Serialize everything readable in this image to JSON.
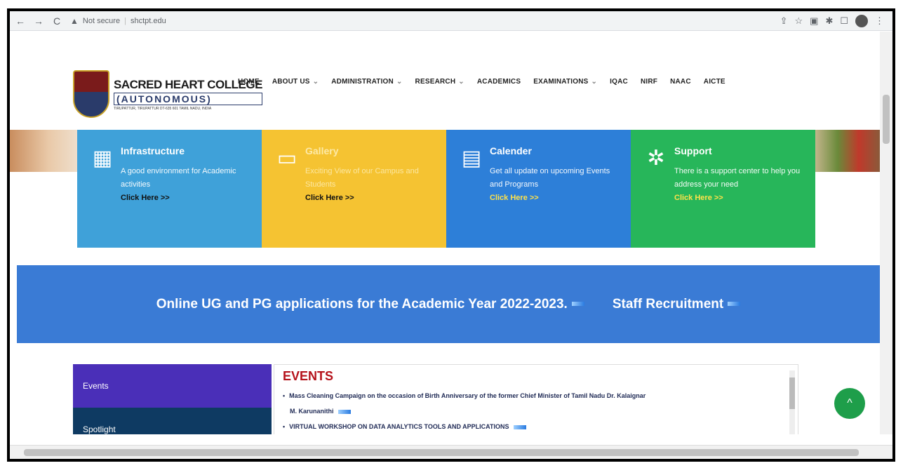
{
  "browser": {
    "back_icon": "←",
    "forward_icon": "→",
    "reload_icon": "C",
    "security_label": "Not secure",
    "url": "shctpt.edu",
    "toolbar_icons": [
      "share-icon",
      "star-icon",
      "extension-icon",
      "puzzle-icon",
      "window-icon",
      "profile-icon",
      "menu-icon"
    ]
  },
  "header": {
    "college_name": "SACRED HEART COLLEGE",
    "college_sub": "(AUTONOMOUS)",
    "college_address": "TIRUPATTUR, TIRUPATTUR DT-635 601 TAMIL NADU, INDIA",
    "nav": [
      {
        "label": "HOME",
        "caret": false
      },
      {
        "label": "ABOUT US",
        "caret": true
      },
      {
        "label": "ADMINISTRATION",
        "caret": true
      },
      {
        "label": "RESEARCH",
        "caret": true
      },
      {
        "label": "ACADEMICS",
        "caret": false
      },
      {
        "label": "EXAMINATIONS",
        "caret": true
      },
      {
        "label": "IQAC",
        "caret": false
      },
      {
        "label": "NIRF",
        "caret": false
      },
      {
        "label": "NAAC",
        "caret": false
      },
      {
        "label": "AICTE",
        "caret": false
      }
    ]
  },
  "tiles": [
    {
      "title": "Infrastructure",
      "desc": "A good environment for Academic activities",
      "cta": "Click Here >>",
      "icon": "building-icon"
    },
    {
      "title": "Gallery",
      "desc": "Exciting View of our Campus and Students",
      "cta": "Click Here >>",
      "icon": "image-icon"
    },
    {
      "title": "Calender",
      "desc": "Get all update on upcoming Events and Programs",
      "cta": "Click Here >>",
      "icon": "calendar-icon"
    },
    {
      "title": "Support",
      "desc": "There is a support center to help you address your need",
      "cta": "Click Here >>",
      "icon": "network-icon"
    }
  ],
  "banner": {
    "item1": "Online UG and PG applications for the Academic Year 2022-2023.",
    "item2": "Staff Recruitment"
  },
  "sidebar": [
    "Events",
    "Spotlight"
  ],
  "events": {
    "heading": "EVENTS",
    "items": [
      "Mass Cleaning Campaign on the occasion of Birth Anniversary of the former Chief Minister of Tamil Nadu Dr. Kalaignar",
      "M. Karunanithi",
      "VIRTUAL WORKSHOP ON DATA ANALYTICS TOOLS AND APPLICATIONS"
    ]
  },
  "fab_icon": "^"
}
